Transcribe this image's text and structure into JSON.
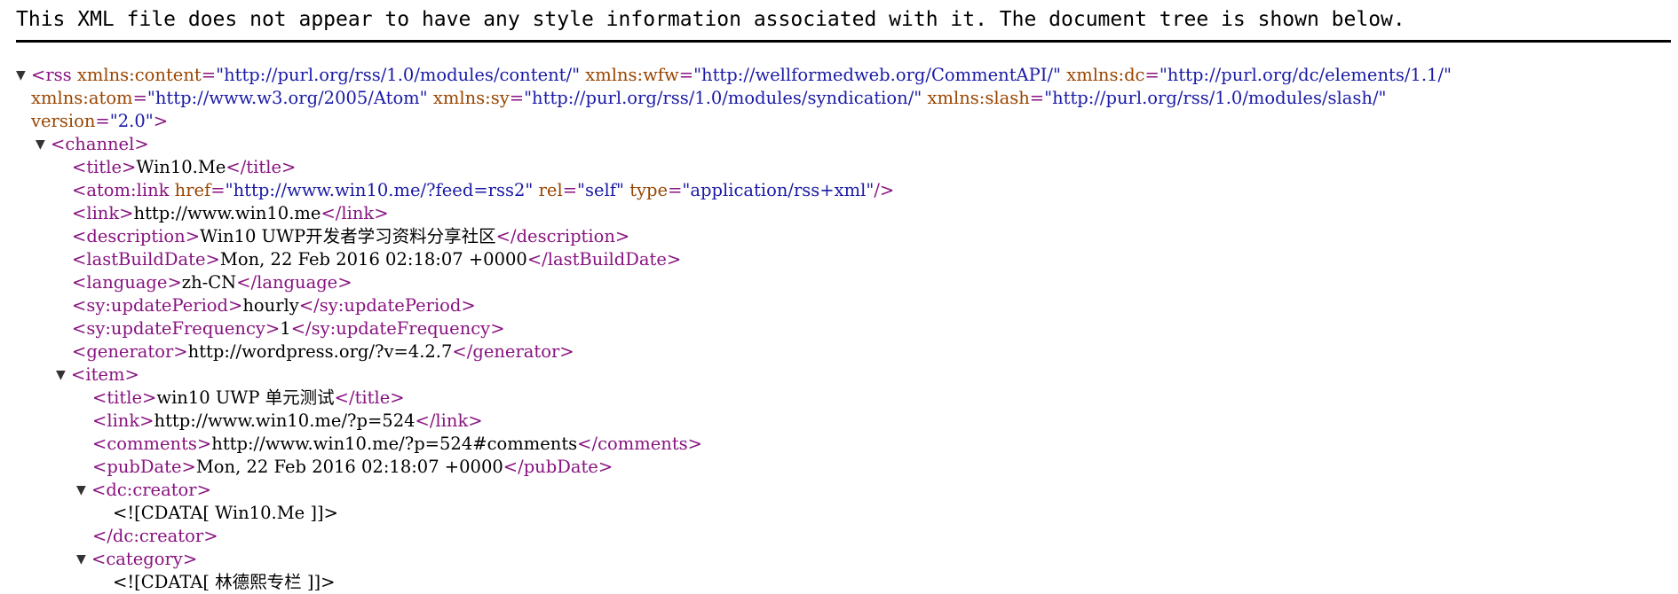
{
  "header": {
    "message": "This XML file does not appear to have any style information associated with it. The document tree is shown below."
  },
  "rss": {
    "toggle": "▼",
    "open": "<rss",
    "attrs": [
      {
        "name": "xmlns:content",
        "value": "\"http://purl.org/rss/1.0/modules/content/\""
      },
      {
        "name": "xmlns:wfw",
        "value": "\"http://wellformedweb.org/CommentAPI/\""
      },
      {
        "name": "xmlns:dc",
        "value": "\"http://purl.org/dc/elements/1.1/\""
      },
      {
        "name": "xmlns:atom",
        "value": "\"http://www.w3.org/2005/Atom\""
      },
      {
        "name": "xmlns:sy",
        "value": "\"http://purl.org/rss/1.0/modules/syndication/\""
      },
      {
        "name": "xmlns:slash",
        "value": "\"http://purl.org/rss/1.0/modules/slash/\""
      },
      {
        "name": "version",
        "value": "\"2.0\""
      }
    ],
    "close_bracket": ">"
  },
  "channel": {
    "toggle": "▼",
    "open": "<channel>",
    "title": {
      "open": "<title>",
      "text": "Win10.Me",
      "close": "</title>"
    },
    "atom_link": {
      "open": "<atom:link",
      "attrs": [
        {
          "name": "href",
          "value": "\"http://www.win10.me/?feed=rss2\""
        },
        {
          "name": "rel",
          "value": "\"self\""
        },
        {
          "name": "type",
          "value": "\"application/rss+xml\""
        }
      ],
      "close": "/>"
    },
    "link": {
      "open": "<link>",
      "text": "http://www.win10.me",
      "close": "</link>"
    },
    "description": {
      "open": "<description>",
      "text": "Win10 UWP开发者学习资料分享社区",
      "close": "</description>"
    },
    "lastBuildDate": {
      "open": "<lastBuildDate>",
      "text": "Mon, 22 Feb 2016 02:18:07 +0000",
      "close": "</lastBuildDate>"
    },
    "language": {
      "open": "<language>",
      "text": "zh-CN",
      "close": "</language>"
    },
    "updatePeriod": {
      "open": "<sy:updatePeriod>",
      "text": "hourly",
      "close": "</sy:updatePeriod>"
    },
    "updateFrequency": {
      "open": "<sy:updateFrequency>",
      "text": "1",
      "close": "</sy:updateFrequency>"
    },
    "generator": {
      "open": "<generator>",
      "text": "http://wordpress.org/?v=4.2.7",
      "close": "</generator>"
    }
  },
  "item": {
    "toggle": "▼",
    "open": "<item>",
    "title": {
      "open": "<title>",
      "text": "win10 UWP 单元测试",
      "close": "</title>"
    },
    "link": {
      "open": "<link>",
      "text": "http://www.win10.me/?p=524",
      "close": "</link>"
    },
    "comments": {
      "open": "<comments>",
      "text": "http://www.win10.me/?p=524#comments",
      "close": "</comments>"
    },
    "pubDate": {
      "open": "<pubDate>",
      "text": "Mon, 22 Feb 2016 02:18:07 +0000",
      "close": "</pubDate>"
    },
    "creator": {
      "toggle": "▼",
      "open": "<dc:creator>",
      "cdata": "<![CDATA[ Win10.Me ]]>",
      "close": "</dc:creator>"
    },
    "category": {
      "toggle": "▼",
      "open": "<category>",
      "cdata": "<![CDATA[ 林德熙专栏 ]]>"
    }
  }
}
